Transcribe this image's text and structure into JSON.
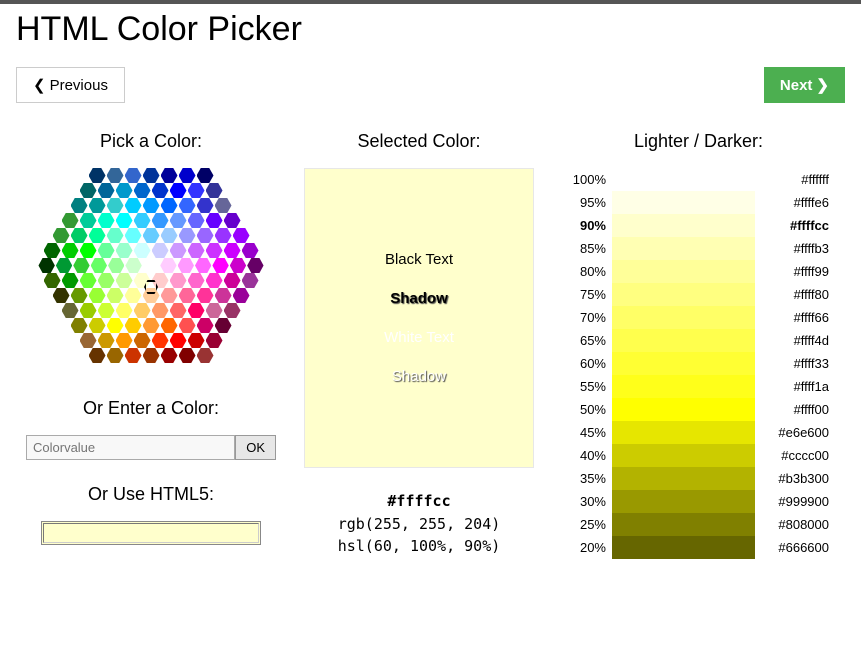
{
  "title": "HTML Color Picker",
  "nav": {
    "prev": "Previous",
    "next": "Next"
  },
  "col1": {
    "pick_heading": "Pick a Color:",
    "enter_heading": "Or Enter a Color:",
    "placeholder": "Colorvalue",
    "ok": "OK",
    "html5_heading": "Or Use HTML5:",
    "html5_color": "#ffffcc"
  },
  "col2": {
    "heading": "Selected Color:",
    "swatch_color": "#ffffcc",
    "sample_black": "Black Text",
    "sample_shadow_b": "Shadow",
    "sample_white": "White Text",
    "sample_shadow_w": "Shadow",
    "hex": "#ffffcc",
    "rgb": "rgb(255, 255, 204)",
    "hsl": "hsl(60, 100%, 90%)"
  },
  "col3": {
    "heading": "Lighter / Darker:",
    "shades": [
      {
        "pct": "100%",
        "color": "#ffffff",
        "hex": "#ffffff",
        "current": false
      },
      {
        "pct": "95%",
        "color": "#ffffe6",
        "hex": "#ffffe6",
        "current": false
      },
      {
        "pct": "90%",
        "color": "#ffffcc",
        "hex": "#ffffcc",
        "current": true
      },
      {
        "pct": "85%",
        "color": "#ffffb3",
        "hex": "#ffffb3",
        "current": false
      },
      {
        "pct": "80%",
        "color": "#ffff99",
        "hex": "#ffff99",
        "current": false
      },
      {
        "pct": "75%",
        "color": "#ffff80",
        "hex": "#ffff80",
        "current": false
      },
      {
        "pct": "70%",
        "color": "#ffff66",
        "hex": "#ffff66",
        "current": false
      },
      {
        "pct": "65%",
        "color": "#ffff4d",
        "hex": "#ffff4d",
        "current": false
      },
      {
        "pct": "60%",
        "color": "#ffff33",
        "hex": "#ffff33",
        "current": false
      },
      {
        "pct": "55%",
        "color": "#ffff1a",
        "hex": "#ffff1a",
        "current": false
      },
      {
        "pct": "50%",
        "color": "#ffff00",
        "hex": "#ffff00",
        "current": false
      },
      {
        "pct": "45%",
        "color": "#e6e600",
        "hex": "#e6e600",
        "current": false
      },
      {
        "pct": "40%",
        "color": "#cccc00",
        "hex": "#cccc00",
        "current": false
      },
      {
        "pct": "35%",
        "color": "#b3b300",
        "hex": "#b3b300",
        "current": false
      },
      {
        "pct": "30%",
        "color": "#999900",
        "hex": "#999900",
        "current": false
      },
      {
        "pct": "25%",
        "color": "#808000",
        "hex": "#808000",
        "current": false
      },
      {
        "pct": "20%",
        "color": "#666600",
        "hex": "#666600",
        "current": false
      }
    ]
  },
  "hex_colors": [
    [
      "#003366",
      "#336699",
      "#3366cc",
      "#003399",
      "#000099",
      "#0000cc",
      "#000066"
    ],
    [
      "#006666",
      "#006699",
      "#0099cc",
      "#0066cc",
      "#0033cc",
      "#0000ff",
      "#3333ff",
      "#333399"
    ],
    [
      "#008080",
      "#009999",
      "#33cccc",
      "#00ccff",
      "#0099ff",
      "#0066ff",
      "#3366ff",
      "#3333cc",
      "#666699"
    ],
    [
      "#339933",
      "#00cc99",
      "#00ffcc",
      "#00ffff",
      "#33ccff",
      "#3399ff",
      "#6699ff",
      "#6666ff",
      "#6600ff",
      "#6600cc"
    ],
    [
      "#339933",
      "#00cc66",
      "#00ff99",
      "#66ffcc",
      "#66ffff",
      "#66ccff",
      "#99ccff",
      "#9999ff",
      "#9966ff",
      "#9933ff",
      "#9900ff"
    ],
    [
      "#006600",
      "#00cc00",
      "#00ff00",
      "#66ff99",
      "#99ffcc",
      "#ccffff",
      "#ccccff",
      "#cc99ff",
      "#cc66ff",
      "#cc33ff",
      "#cc00ff",
      "#9900cc"
    ],
    [
      "#003300",
      "#009933",
      "#33cc33",
      "#66ff66",
      "#99ff99",
      "#ccffcc",
      "#ffffff",
      "#ffccff",
      "#ff99ff",
      "#ff66ff",
      "#ff00ff",
      "#cc00cc",
      "#660066"
    ],
    [
      "#336600",
      "#009900",
      "#66ff33",
      "#99ff66",
      "#ccff99",
      "#ffffcc",
      "#ffcccc",
      "#ff99cc",
      "#ff66cc",
      "#ff33cc",
      "#cc0099",
      "#993399"
    ],
    [
      "#333300",
      "#669900",
      "#99ff33",
      "#ccff66",
      "#ffff99",
      "#ffcc99",
      "#ff9999",
      "#ff6699",
      "#ff3399",
      "#cc3399",
      "#990099"
    ],
    [
      "#666633",
      "#99cc00",
      "#ccff33",
      "#ffff66",
      "#ffcc66",
      "#ff9966",
      "#ff6666",
      "#ff0066",
      "#cc6699",
      "#993366"
    ],
    [
      "#808000",
      "#cccc00",
      "#ffff00",
      "#ffcc00",
      "#ff9933",
      "#ff6600",
      "#ff5050",
      "#cc0066",
      "#660033"
    ],
    [
      "#996633",
      "#cc9900",
      "#ff9900",
      "#cc6600",
      "#ff3300",
      "#ff0000",
      "#cc0000",
      "#990033"
    ],
    [
      "#663300",
      "#996600",
      "#cc3300",
      "#993300",
      "#990000",
      "#800000",
      "#993333"
    ]
  ]
}
